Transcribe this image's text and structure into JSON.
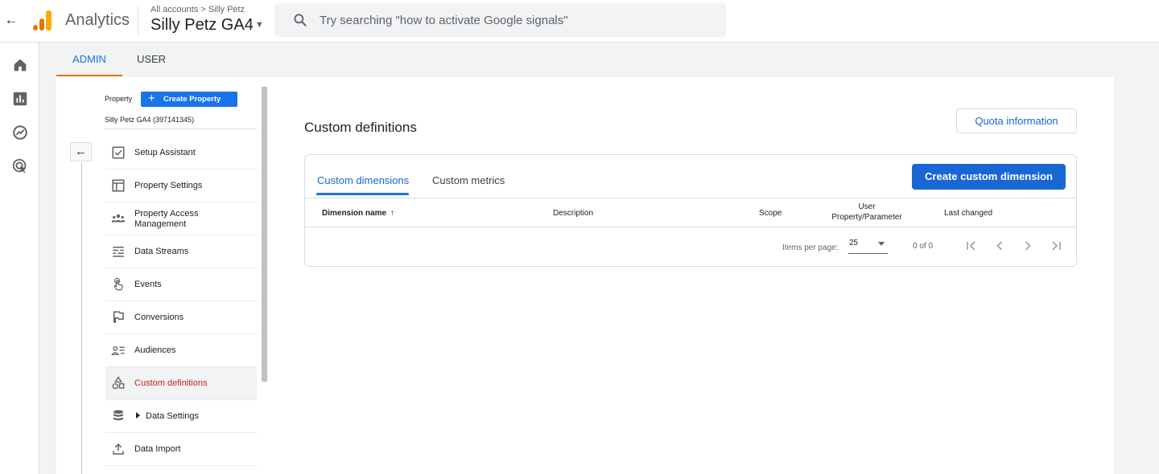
{
  "header": {
    "product_name": "Analytics",
    "breadcrumb": "All accounts > Silly Petz",
    "account_name": "Silly Petz GA4",
    "search_placeholder": "Try searching \"how to activate Google signals\""
  },
  "rail": {
    "icons": [
      "home-icon",
      "reports-icon",
      "explore-icon",
      "advertising-icon"
    ]
  },
  "tabs": {
    "admin": "ADMIN",
    "user": "USER"
  },
  "property": {
    "label": "Property",
    "create_button": "Create Property",
    "name": "Silly Petz GA4 (397141345)"
  },
  "nav": {
    "items": [
      {
        "label": "Setup Assistant",
        "icon": "checkbox-icon"
      },
      {
        "label": "Property Settings",
        "icon": "layout-icon"
      },
      {
        "label": "Property Access",
        "label2": "Management",
        "icon": "people-icon"
      },
      {
        "label": "Data Streams",
        "icon": "streams-icon"
      },
      {
        "label": "Events",
        "icon": "touch-icon"
      },
      {
        "label": "Conversions",
        "icon": "flag-icon"
      },
      {
        "label": "Audiences",
        "icon": "audience-icon"
      },
      {
        "label": "Custom definitions",
        "icon": "shapes-icon",
        "active": true
      },
      {
        "label": "Data Settings",
        "icon": "database-icon"
      },
      {
        "label": "Data Import",
        "icon": "upload-icon"
      }
    ]
  },
  "content": {
    "title": "Custom definitions",
    "quota_button": "Quota information",
    "tab_dimensions": "Custom dimensions",
    "tab_metrics": "Custom metrics",
    "create_button": "Create custom dimension",
    "columns": {
      "name": "Dimension name",
      "description": "Description",
      "scope": "Scope",
      "user_property_line1": "User",
      "user_property_line2": "Property/Parameter",
      "last_changed": "Last changed"
    },
    "pager": {
      "label": "Items per page:",
      "page_size": "25",
      "count": "0 of 0"
    }
  }
}
